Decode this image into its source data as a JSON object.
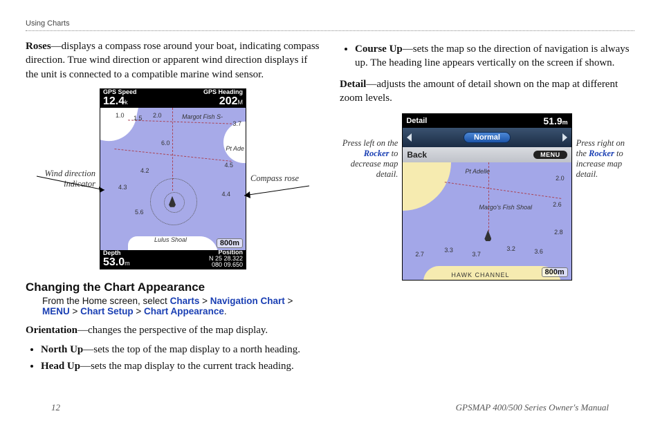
{
  "header": {
    "section": "Using Charts"
  },
  "footer": {
    "page": "12",
    "manual": "GPSMAP 400/500 Series Owner's Manual"
  },
  "left": {
    "roses_term": "Roses",
    "roses_text": "—displays a compass rose around your boat, indicating compass direction. True wind direction or apparent wind direction displays if the unit is connected to a compatible marine wind sensor.",
    "fig": {
      "call_left": "Wind direction indicator",
      "call_right": "Compass rose",
      "top_left_label": "GPS Speed",
      "top_left_value": "12.4",
      "top_left_unit": "k",
      "top_right_label": "GPS Heading",
      "top_right_value": "202",
      "top_right_unit": "M",
      "bottom_left_label": "Depth",
      "bottom_left_value": "53.0",
      "bottom_left_unit": "m",
      "bottom_right_label": "Position",
      "bottom_right_value1": "N 25 28.322",
      "bottom_right_value2": "080 09.650",
      "scale": "800m",
      "depths": [
        "1.0",
        "1.5",
        "2.0",
        "3.7",
        "4.5",
        "4.4",
        "4.2",
        "4.3",
        "5.6",
        "6.0"
      ],
      "labels": [
        "Margot Fish S-",
        "Pt Ade",
        "Lulus Shoal"
      ]
    },
    "h2": "Changing the Chart Appearance",
    "navpath_pre": "From the Home screen, select ",
    "navpath": [
      "Charts",
      "Navigation Chart",
      "MENU",
      "Chart Setup",
      "Chart Appearance"
    ],
    "orient_term": "Orientation",
    "orient_text": "—changes the perspective of the map display.",
    "items": [
      {
        "term": "North Up",
        "text": "—sets the top of the map display to a north heading."
      },
      {
        "term": "Head Up",
        "text": "—sets the map display to the current track heading."
      }
    ]
  },
  "right": {
    "items": [
      {
        "term": "Course Up",
        "text": "—sets the map so the direction of navigation is always up. The heading line appears vertically on the screen if shown."
      }
    ],
    "detail_term": "Detail",
    "detail_text": "—adjusts the amount of detail shown on the map at different zoom levels.",
    "fig": {
      "cap_left_1": "Press left on the ",
      "cap_left_rk": "Rocker",
      "cap_left_2": " to decrease map detail.",
      "cap_right_1": "Press right on the ",
      "cap_right_rk": "Rocker",
      "cap_right_2": " to increase map detail.",
      "hdr_left": "Detail",
      "hdr_value": "51.9",
      "hdr_unit": "m",
      "selector": "Normal",
      "back": "Back",
      "menu": "MENU",
      "scale": "800m",
      "depths": [
        "2.0",
        "2.6",
        "2.8",
        "2.7",
        "3.3",
        "3.7",
        "3.2",
        "3.6"
      ],
      "labels": [
        "Pt Adelle",
        "Margo's Fish Shoal",
        "HAWK CHANNEL"
      ]
    }
  }
}
